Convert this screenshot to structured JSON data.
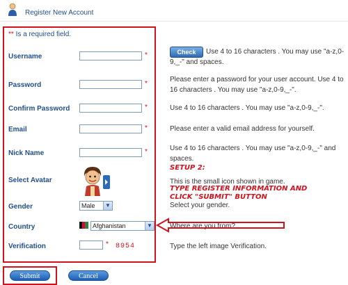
{
  "header": {
    "title": "Register New Account"
  },
  "form": {
    "required_note_star": "**",
    "required_note_text": " Is a required field.",
    "required_mark": "*",
    "fields": {
      "username": {
        "label": "Username",
        "hint": "Use 4 to 16 characters . You may use \"a-z,0-9,_-\" and spaces.",
        "check_label": "Check"
      },
      "password": {
        "label": "Password",
        "hint": "Please enter a password for your user account. Use 4 to 16 characters . You may use \"a-z,0-9,_-\"."
      },
      "confirm_password": {
        "label": "Confirm Password",
        "hint": "Use 4 to 16 characters . You may use \"a-z,0-9,_-\"."
      },
      "email": {
        "label": "Email",
        "hint": "Please enter a valid email address for yourself."
      },
      "nick_name": {
        "label": "Nick Name",
        "hint": "Use 4 to 16 characters . You may use \"a-z,0-9,_-\" and spaces."
      },
      "avatar": {
        "label": "Select Avatar",
        "hint": "This is the small icon shown in game."
      },
      "gender": {
        "label": "Gender",
        "value": "Male",
        "hint": "Select your gender."
      },
      "country": {
        "label": "Country",
        "value": "Afghanistan",
        "hint": "Where are you from?"
      },
      "verification": {
        "label": "Verification",
        "code": "8954",
        "hint": "Type the left image Verification."
      }
    }
  },
  "buttons": {
    "submit": "Submit",
    "cancel": "Cancel"
  },
  "annotation": {
    "step": "SETUP 2:",
    "instruction_line1": "TYPE REGISTER INFORMATION AND",
    "instruction_line2": "CLICK \"SUBMIT\" BUTTON",
    "color": "#d1121d"
  }
}
